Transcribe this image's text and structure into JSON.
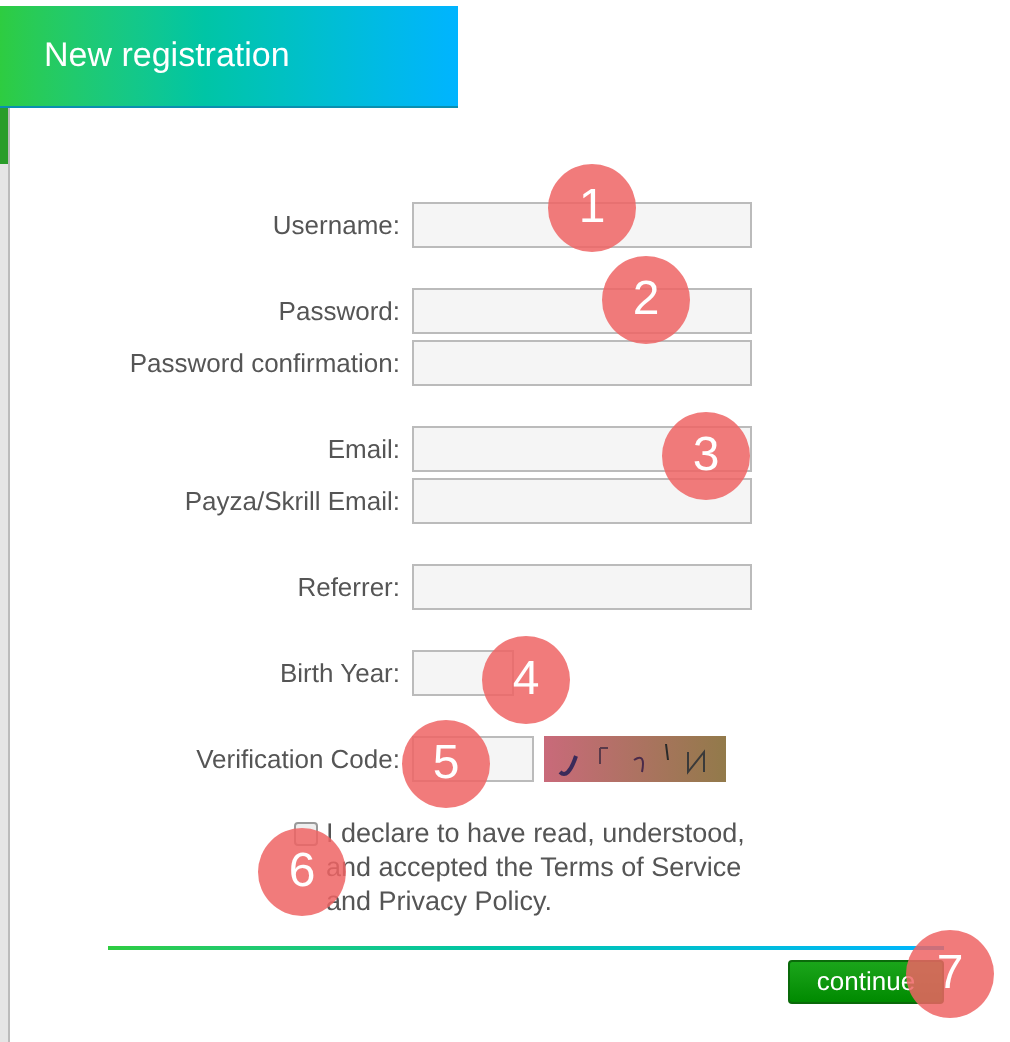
{
  "header": {
    "title": "New registration"
  },
  "groups": [
    [
      {
        "label": "Username:",
        "kind": "text"
      }
    ],
    [
      {
        "label": "Password:",
        "kind": "text"
      },
      {
        "label": "Password confirmation:",
        "kind": "text"
      }
    ],
    [
      {
        "label": "Email:",
        "kind": "text"
      },
      {
        "label": "Payza/Skrill Email:",
        "kind": "text"
      }
    ],
    [
      {
        "label": "Referrer:",
        "kind": "text"
      }
    ],
    [
      {
        "label": "Birth Year:",
        "kind": "short"
      }
    ],
    [
      {
        "label": "Verification Code:",
        "kind": "captcha"
      }
    ]
  ],
  "agreement": {
    "checked": false,
    "text": "I declare to have read, understood, and accepted the Terms of Service and Privacy Policy."
  },
  "button": "continue",
  "markers": [
    {
      "number": "1"
    },
    {
      "number": "2"
    },
    {
      "number": "3"
    },
    {
      "number": "4"
    },
    {
      "number": "5"
    },
    {
      "number": "6"
    },
    {
      "number": "7"
    }
  ]
}
